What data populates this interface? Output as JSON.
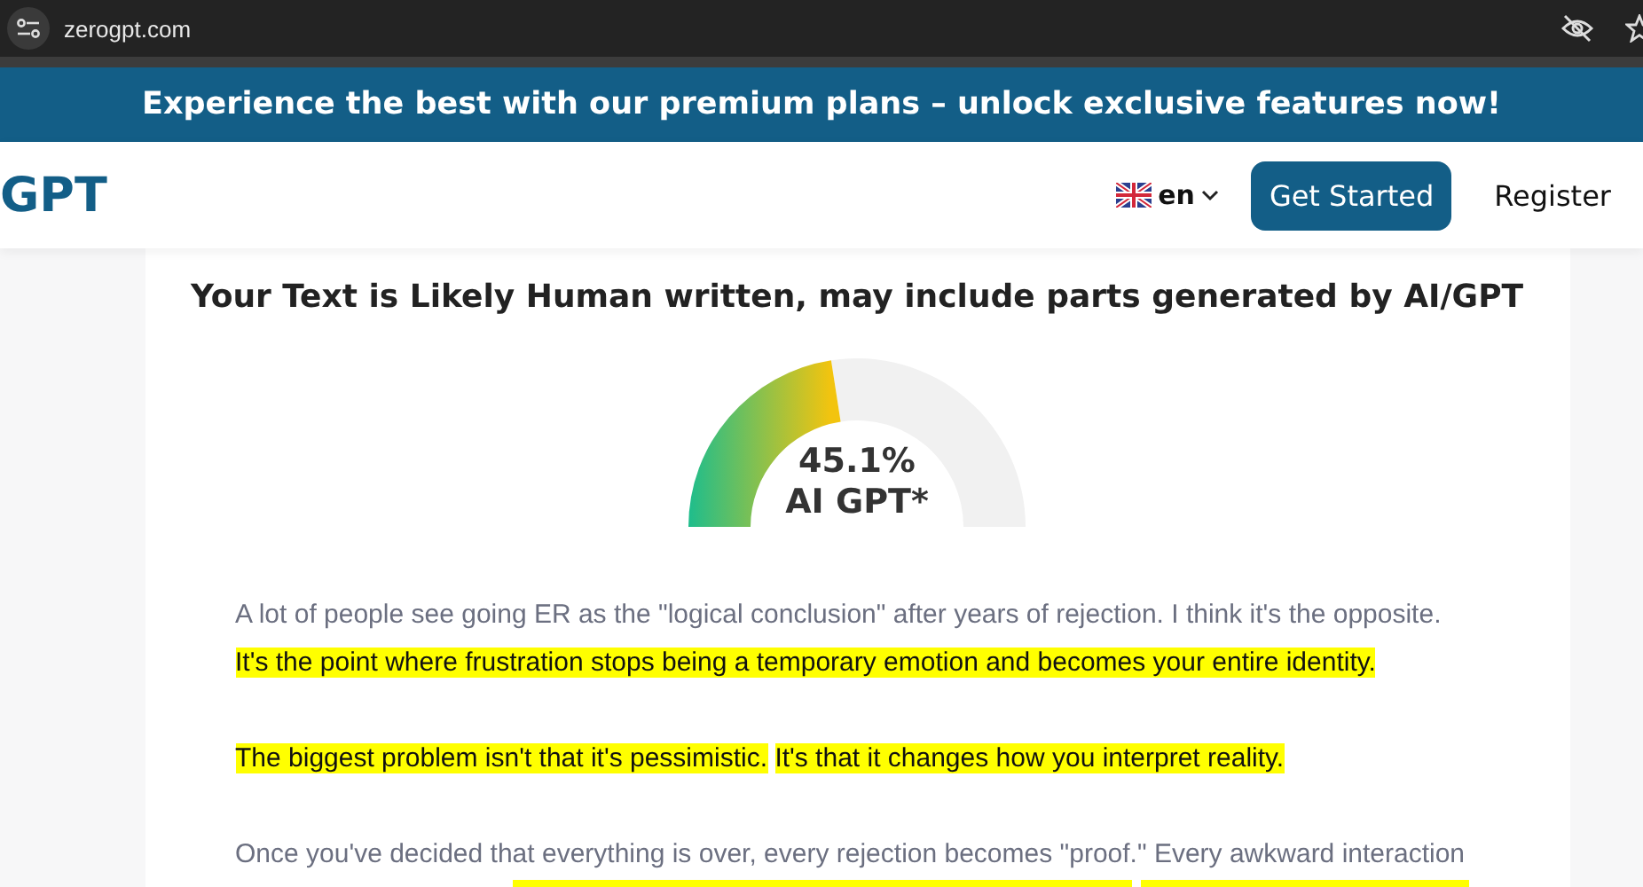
{
  "browser": {
    "url": "zerogpt.com"
  },
  "banner": {
    "text": "Experience the best with our premium plans – unlock exclusive features now!"
  },
  "header": {
    "logo": "GPT",
    "language": "en",
    "buttons": [
      {
        "label": "Get Started",
        "kind": "primary"
      },
      {
        "label": "Register",
        "kind": "link"
      }
    ]
  },
  "result": {
    "title": "Your Text is Likely Human written, may include parts generated by AI/GPT",
    "gauge": {
      "value": "45.1%",
      "label": "AI GPT*"
    }
  },
  "paragraphs": [
    {
      "segments": [
        {
          "text": "A lot of people see going ER as the \"logical conclusion\" after years of rejection. I think it's the opposite.",
          "highlighted": false
        },
        {
          "text": "It's the point where frustration stops being a temporary emotion and becomes your entire identity.",
          "highlighted": true
        }
      ]
    },
    {
      "segments": [
        {
          "text": "The biggest problem isn't that it's pessimistic.",
          "highlighted": true
        },
        {
          "text": "It's that it changes how you interpret reality.",
          "highlighted": true
        }
      ]
    },
    {
      "segments": [
        {
          "text": "Once you've decided that everything is over, every rejection becomes \"proof.\" Every awkward interaction",
          "highlighted": false
        }
      ]
    }
  ]
}
